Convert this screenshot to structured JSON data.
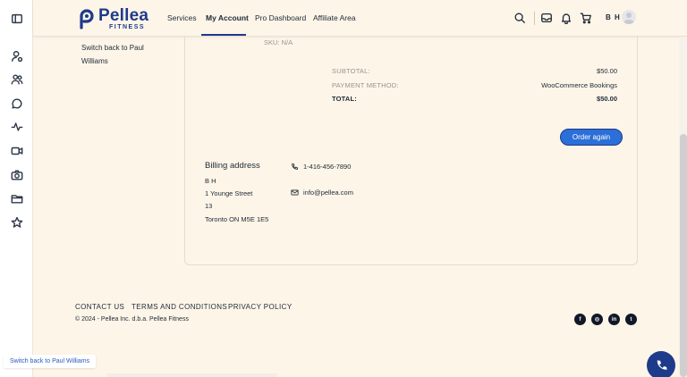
{
  "brand": {
    "title": "Pellea",
    "subtitle": "FITNESS",
    "color": "#1e3a8a"
  },
  "nav": {
    "items": [
      {
        "label": "Services"
      },
      {
        "label": "My Account"
      },
      {
        "label": "Pro Dashboard"
      },
      {
        "label": "Affiliate Area"
      }
    ],
    "active": "My Account"
  },
  "header": {
    "icons": [
      "search-icon",
      "inbox-icon",
      "bell-icon",
      "cart-icon"
    ],
    "user_initials": "B H"
  },
  "sidebar": {
    "icons": [
      "panel-toggle-icon",
      "user-icon",
      "users-icon",
      "chat-icon",
      "activity-icon",
      "video-icon",
      "camera-icon",
      "folder-icon",
      "star-icon"
    ]
  },
  "account_nav": {
    "switch_back_line1": "Switch back to Paul",
    "switch_back_line2": "Williams"
  },
  "order": {
    "sku": "SKU: N/A",
    "subtotal_label": "SUBTOTAL:",
    "subtotal_value": "$50.00",
    "payment_label": "PAYMENT METHOD:",
    "payment_value": "WooCommerce Bookings",
    "total_label": "TOTAL:",
    "total_value": "$50.00",
    "order_again_label": "Order again"
  },
  "billing": {
    "title": "Billing address",
    "name": "B H",
    "street": "1 Younge Street",
    "unit": "13",
    "city": "Toronto ON M5E 1E5",
    "phone": "1-416-456-7890",
    "email": "info@pellea.com"
  },
  "footer": {
    "links": [
      {
        "label": "CONTACT US"
      },
      {
        "label": "TERMS AND CONDITIONS"
      },
      {
        "label": "PRIVACY POLICY"
      }
    ],
    "copyright": "© 2024 - Pellea Inc. d.b.a. Pellea Fitness",
    "social": [
      {
        "name": "facebook-icon",
        "glyph": "f"
      },
      {
        "name": "instagram-icon",
        "glyph": "◎"
      },
      {
        "name": "linkedin-icon",
        "glyph": "in"
      },
      {
        "name": "twitter-icon",
        "glyph": "t"
      }
    ]
  },
  "switch_pill": {
    "label": "Switch back to Paul Williams"
  },
  "colors": {
    "background": "#fdf5e8",
    "accent": "#2b6fd8",
    "brand": "#1e3a8a"
  }
}
